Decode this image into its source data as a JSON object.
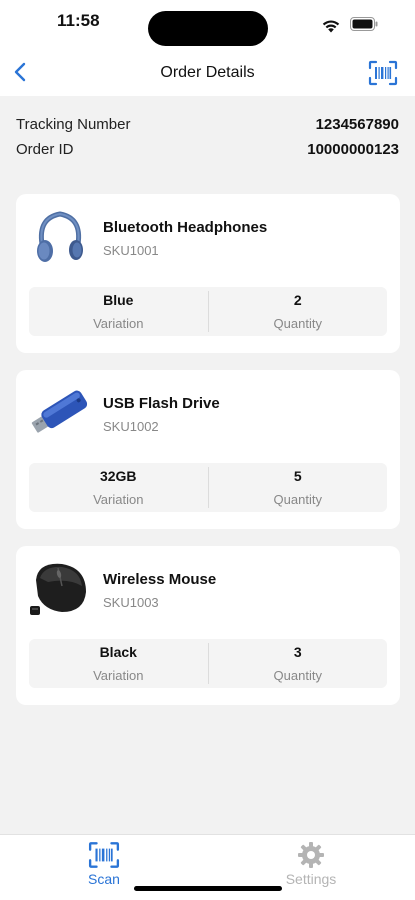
{
  "status_bar": {
    "time": "11:58"
  },
  "nav": {
    "title": "Order Details"
  },
  "order": {
    "tracking_label": "Tracking Number",
    "tracking_value": "1234567890",
    "order_id_label": "Order ID",
    "order_id_value": "10000000123"
  },
  "items": [
    {
      "name": "Bluetooth Headphones",
      "sku": "SKU1001",
      "variation": "Blue",
      "variation_label": "Variation",
      "quantity": "2",
      "quantity_label": "Quantity",
      "image_icon": "headphones"
    },
    {
      "name": "USB Flash Drive",
      "sku": "SKU1002",
      "variation": "32GB",
      "variation_label": "Variation",
      "quantity": "5",
      "quantity_label": "Quantity",
      "image_icon": "usb-drive"
    },
    {
      "name": "Wireless Mouse",
      "sku": "SKU1003",
      "variation": "Black",
      "variation_label": "Variation",
      "quantity": "3",
      "quantity_label": "Quantity",
      "image_icon": "mouse"
    }
  ],
  "tabs": [
    {
      "label": "Scan",
      "icon": "barcode-scan",
      "active": true
    },
    {
      "label": "Settings",
      "icon": "gear",
      "active": false
    }
  ],
  "colors": {
    "accent": "#2a74d6",
    "inactive": "#b4b4b4",
    "background": "#f2f2f2"
  }
}
